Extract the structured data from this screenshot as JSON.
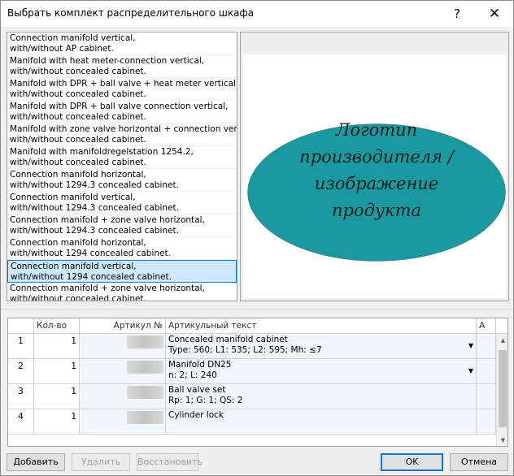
{
  "window": {
    "title": "Выбрать комплект распределительного шкафа",
    "help_glyph": "?",
    "close_glyph": "✕"
  },
  "kit_list": [
    {
      "line1": "Connection manifold vertical,",
      "line2": "with/without AP cabinet."
    },
    {
      "line1": "Manifold with heat meter-connection vertical,",
      "line2": "with/without concealed cabinet."
    },
    {
      "line1": "Manifold with DPR  + ball valve  + heat meter vertical,",
      "line2": "with/without concealed cabinet."
    },
    {
      "line1": "Manifold with DPR + ball valve connection vertical,",
      "line2": "with/without concealed cabinet."
    },
    {
      "line1": "Manifold with zone valve horizontal  + connection vertical,",
      "line2": "with/without concealed cabinet."
    },
    {
      "line1": "Manifold with manifoldregelstation 1254.2,",
      "line2": "with/without concealed cabinet."
    },
    {
      "line1": "Connection manifold horizontal,",
      "line2": "with/without 1294.3 concealed cabinet."
    },
    {
      "line1": "Connection manifold vertical,",
      "line2": "with/without 1294.3 concealed cabinet."
    },
    {
      "line1": "Connection manifold +  zone valve horizontal,",
      "line2": "with/without 1294.3 concealed cabinet."
    },
    {
      "line1": "Connection manifold horizontal,",
      "line2": "with/without 1294 concealed cabinet."
    },
    {
      "line1": "Connection manifold vertical,",
      "line2": "with/without 1294 concealed cabinet."
    },
    {
      "line1": "Connection manifold +  zone valve horizontal,",
      "line2": "with/without concealed cabinet."
    }
  ],
  "selected_index": 10,
  "preview": {
    "logo_lines": [
      "Логотип",
      "производителя /",
      "изображение",
      "продукта"
    ],
    "ellipse_color": "#1a9aa0"
  },
  "grid": {
    "headers": {
      "num": "",
      "qty": "Кол-во",
      "article": "Артикул №",
      "text": "Артикульный текст",
      "a": "A"
    },
    "rows": [
      {
        "num": "1",
        "qty": "1",
        "text1": "Concealed manifold cabinet",
        "text2": "Type: 560;  L1: 535;  L2: 595;  Mh: ≤7"
      },
      {
        "num": "2",
        "qty": "1",
        "text1": "Manifold DN25",
        "text2": "n: 2;  L: 240"
      },
      {
        "num": "3",
        "qty": "1",
        "text1": "Ball valve set",
        "text2": "Rp: 1;  G: 1;  QS: 2"
      },
      {
        "num": "4",
        "qty": "1",
        "text1": "Cylinder lock",
        "text2": ""
      }
    ]
  },
  "buttons": {
    "add": "Добавить",
    "delete": "Удалить",
    "restore": "Восстановить",
    "ok": "OK",
    "cancel": "Отмена"
  },
  "colors": {
    "selection_bg": "#cde8ff",
    "selection_border": "#0078d7",
    "accent": "#0078d7"
  }
}
